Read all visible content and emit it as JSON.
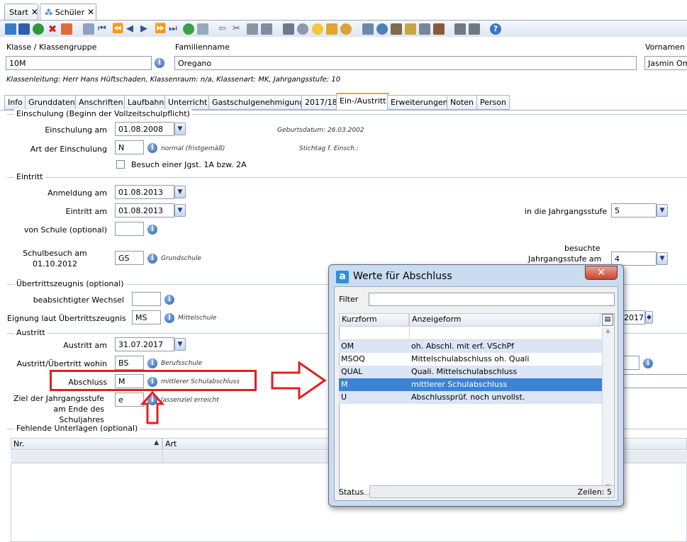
{
  "tabs": [
    {
      "label": "Start",
      "close": "✕"
    },
    {
      "label": "Schüler",
      "close": "✕"
    }
  ],
  "header": {
    "klasse_label": "Klasse / Klassengruppe",
    "klasse_value": "10M",
    "familienname_label": "Familienname",
    "familienname_value": "Oregano",
    "vornamen_label": "Vornamen",
    "vornamen_value": "Jasmin Om",
    "info_line": "Klassenleitung: Herr Hans Hüftschaden, Klassenraum: n/a, Klassenart: MK, Jahrgangsstufe: 10"
  },
  "page_tabs": [
    "Info",
    "Grunddaten",
    "Anschriften",
    "Laufbahn",
    "Unterricht",
    "Gastschulgenehmigung",
    "2017/18",
    "Ein-/Austritt",
    "Erweiterungen",
    "Noten",
    "Person"
  ],
  "active_tab": "Ein-/Austritt",
  "einschulung": {
    "section": "Einschulung (Beginn der Vollzeitschulpflicht)",
    "am_label": "Einschulung am",
    "am_value": "01.08.2008",
    "geburtsdatum": "Geburtsdatum: 26.03.2002",
    "art_label": "Art der Einschulung",
    "art_value": "N",
    "art_hint": "normal (fristgemäß)",
    "stichtag": "Stichtag f. Einsch.:",
    "besuch_label": "Besuch einer Jgst. 1A bzw. 2A"
  },
  "eintritt": {
    "section": "Eintritt",
    "anmeldung_label": "Anmeldung am",
    "anmeldung_value": "01.08.2013",
    "eintritt_label": "Eintritt am",
    "eintritt_value": "01.08.2013",
    "jgst_label": "in die Jahrgangsstufe",
    "jgst_value": "5",
    "vonschule_label": "von Schule (optional)",
    "vonschule_value": "",
    "schulbesuch_label_1": "Schulbesuch am",
    "schulbesuch_label_2": "01.10.2012",
    "schulbesuch_value": "GS",
    "schulbesuch_hint": "Grundschule",
    "besuchte_label_1": "besuchte",
    "besuchte_label_2": "Jahrgangsstufe am",
    "besuchte_value": "4"
  },
  "uebertritt": {
    "section": "Übertrittszeugnis (optional)",
    "wechsel_label": "beabsichtigter Wechsel",
    "wechsel_value": "",
    "eignung_label": "Eignung laut Übertrittszeugnis",
    "eignung_value": "MS",
    "eignung_hint": "Mittelschule",
    "right_value": "2017"
  },
  "austritt": {
    "section": "Austritt",
    "am_label": "Austritt am",
    "am_value": "31.07.2017",
    "wohin_label": "Austritt/Übertritt wohin",
    "wohin_value": "BS",
    "wohin_hint": "Berufsschule",
    "abschluss_label": "Abschluss",
    "abschluss_value": "M",
    "abschluss_hint": "mittlerer Schulabschluss",
    "ziel_label_1": "Ziel der Jahrgangsstufe",
    "ziel_label_2": "am Ende des",
    "ziel_label_3": "Schuljahres",
    "ziel_value": "e",
    "ziel_hint": "lassenziel erreicht"
  },
  "fehlende": {
    "section": "Fehlende Unterlagen (optional)",
    "col_nr": "Nr.",
    "col_art": "Art"
  },
  "dialog": {
    "title": "Werte für Abschluss",
    "logo": "a",
    "close": "✕",
    "filter_label": "Filter",
    "filter_value": "",
    "col_kurz": "Kurzform",
    "col_anzeige": "Anzeigeform",
    "rows": [
      {
        "kurz": "OM",
        "anzeige": "oh. Abschl. mit erf. VSchPf"
      },
      {
        "kurz": "MSOQ",
        "anzeige": "Mittelschulabschluss oh. Quali"
      },
      {
        "kurz": "QUAL",
        "anzeige": "Quali. Mittelschulabschluss"
      },
      {
        "kurz": "M",
        "anzeige": "mittlerer Schulabschluss"
      },
      {
        "kurz": "U",
        "anzeige": "Abschlussprüf. noch unvollst."
      }
    ],
    "selected": "M",
    "status_label": "Status",
    "zeilen": "Zeilen: 5"
  },
  "colors": {
    "accent": "#e7a336",
    "selection": "#3d82d6",
    "annotation": "#e02020",
    "dialog_frame": "#c9dcf2"
  }
}
